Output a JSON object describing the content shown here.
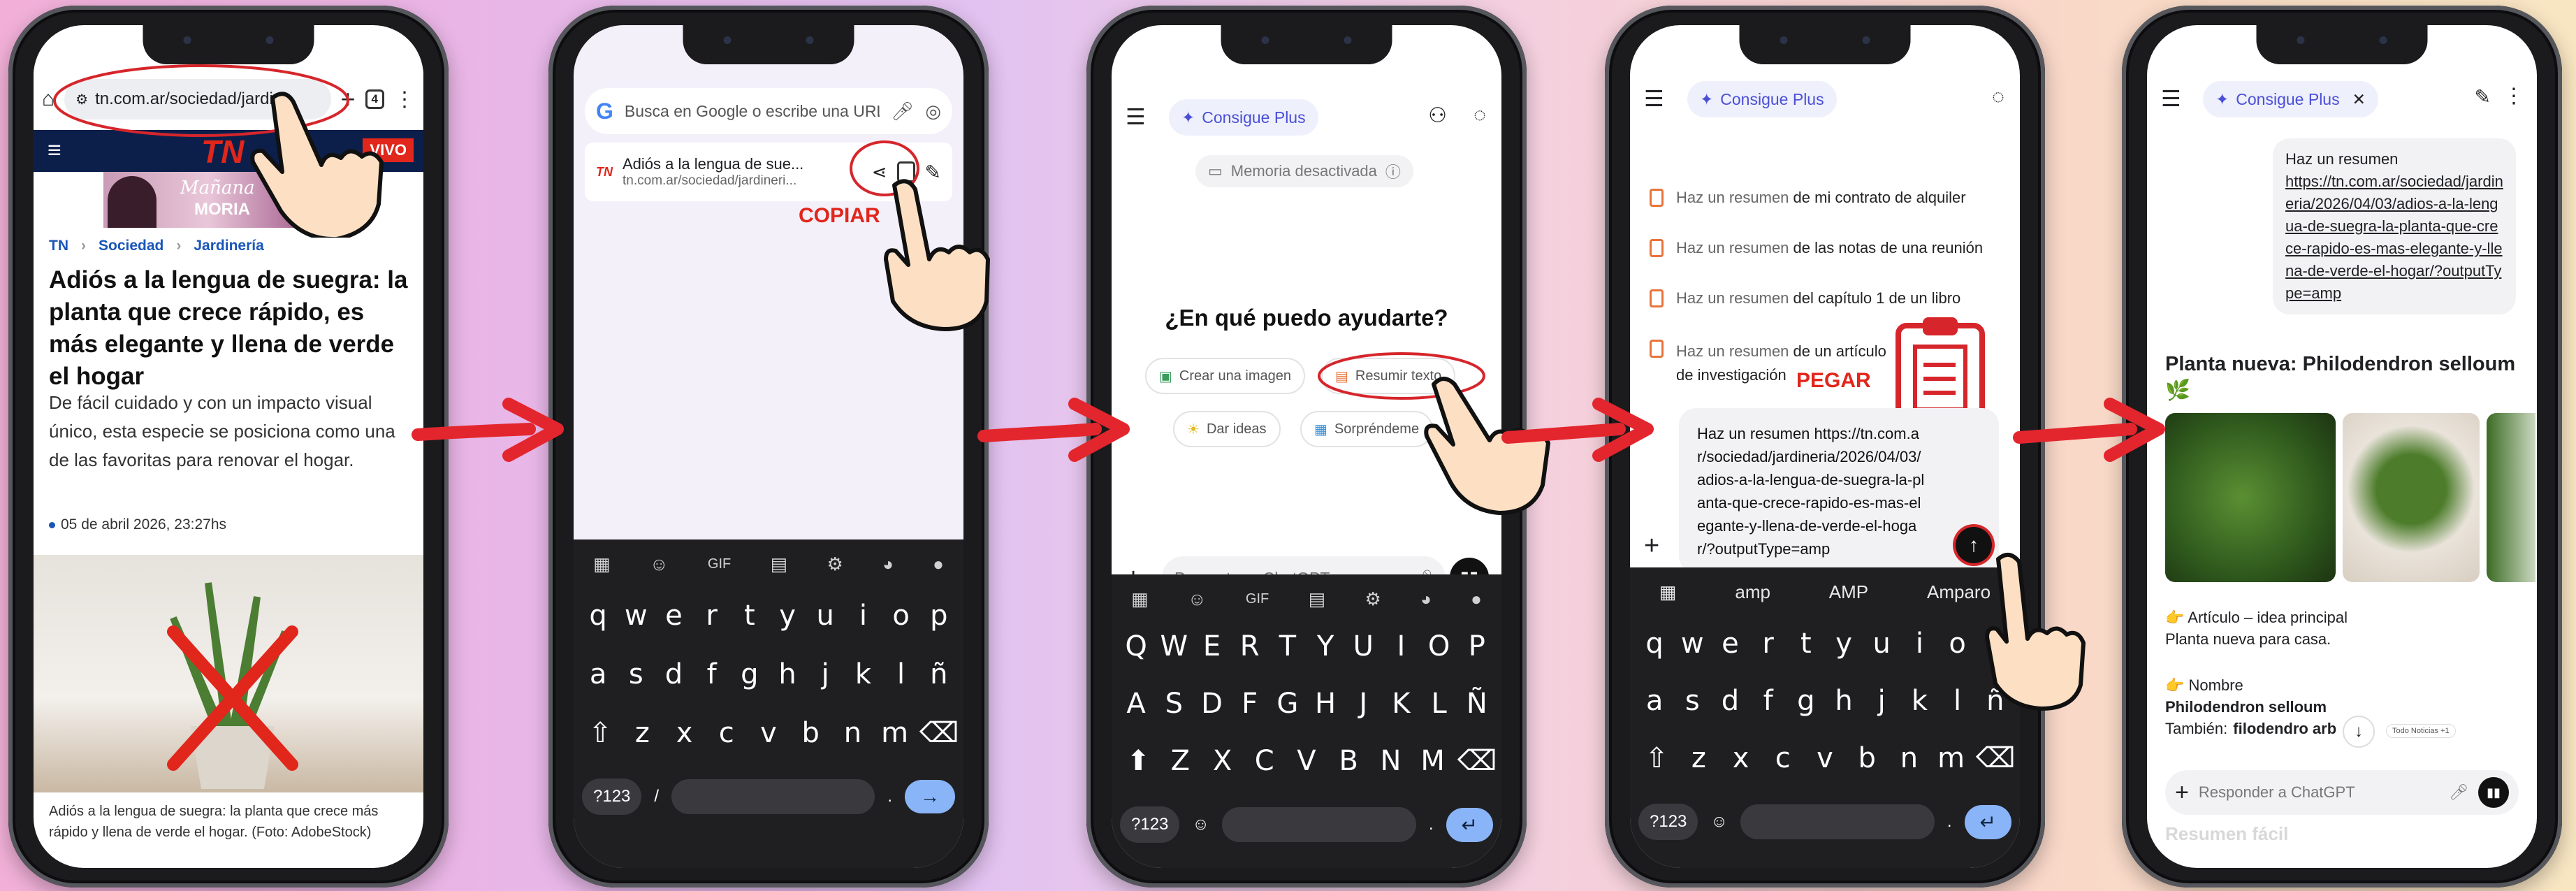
{
  "p1": {
    "url": "tn.com.ar/sociedad/jardi",
    "tab_count": "4",
    "banner": "Mañana",
    "banner2": "MORIA",
    "tn_logo": "TN",
    "vivo": "VIVO",
    "breadcrumb": [
      "TN",
      "Sociedad",
      "Jardinería"
    ],
    "title": "Adiós a la lengua de suegra: la planta que crece rápido, es más elegante y llena de verde el hogar",
    "lead": "De fácil cuidado y con un impacto visual único, esta especie se posiciona como una de las favoritas para renovar el hogar.",
    "date": "05 de abril 2026, 23:27hs",
    "caption": "Adiós a la lengua de suegra: la planta que crece más rápido y llena de verde el hogar. (Foto: AdobeStock)"
  },
  "p2": {
    "search_placeholder": "Busca en Google o escribe una URL",
    "result_title": "Adiós a la lengua de sue...",
    "result_url": "tn.com.ar/sociedad/jardineri...",
    "copiar": "COPIAR",
    "gif": "GIF",
    "rows": [
      [
        "q",
        "w",
        "e",
        "r",
        "t",
        "y",
        "u",
        "i",
        "o",
        "p"
      ],
      [
        "a",
        "s",
        "d",
        "f",
        "g",
        "h",
        "j",
        "k",
        "l",
        "ñ"
      ],
      [
        "z",
        "x",
        "c",
        "v",
        "b",
        "n",
        "m"
      ]
    ],
    "num": "?123",
    "slash": "/",
    "dot": "."
  },
  "p3": {
    "plan": "Consigue Plus",
    "memory": "Memoria desactivada",
    "question": "¿En qué puedo ayudarte?",
    "chips": [
      "Crear una imagen",
      "Resumir texto",
      "Dar ideas",
      "Sorpréndeme"
    ],
    "input_placeholder": "Preguntar a ChatGPT",
    "gif": "GIF",
    "rows": [
      [
        "Q",
        "W",
        "E",
        "R",
        "T",
        "Y",
        "U",
        "I",
        "O",
        "P"
      ],
      [
        "A",
        "S",
        "D",
        "F",
        "G",
        "H",
        "J",
        "K",
        "L",
        "Ñ"
      ],
      [
        "Z",
        "X",
        "C",
        "V",
        "B",
        "N",
        "M"
      ]
    ],
    "num": "?123",
    "dot": "."
  },
  "p4": {
    "plan": "Consigue Plus",
    "suggestions": [
      {
        "a": "Haz un resumen",
        "b": "de mi contrato de alquiler"
      },
      {
        "a": "Haz un resumen",
        "b": "de las notas de una reunión"
      },
      {
        "a": "Haz un resumen",
        "b": "del capítulo 1 de un libro"
      },
      {
        "a": "Haz un resumen",
        "b": "de un artículo de investigación"
      }
    ],
    "pegar": "PEGAR",
    "input_text": "Haz un resumen https://tn.com.ar/sociedad/jardineria/2026/04/03/adios-a-la-lengua-de-suegra-la-planta-que-crece-rapido-es-mas-elegante-y-llena-de-verde-el-hogar/?outputType=amp",
    "kb_suggestions": [
      "amp",
      "AMP",
      "Amparo"
    ],
    "rows": [
      [
        "q",
        "w",
        "e",
        "r",
        "t",
        "y",
        "u",
        "i",
        "o",
        "p"
      ],
      [
        "a",
        "s",
        "d",
        "f",
        "g",
        "h",
        "j",
        "k",
        "l",
        "ñ"
      ],
      [
        "z",
        "x",
        "c",
        "v",
        "b",
        "n",
        "m"
      ]
    ],
    "num": "?123",
    "dot": "."
  },
  "p5": {
    "plan": "Consigue Plus",
    "user_msg_intro": "Haz un resumen",
    "user_msg_link": "https://tn.com.ar/sociedad/jardineria/2026/04/03/adios-a-la-lengua-de-suegra-la-planta-que-crece-rapido-es-mas-elegante-y-llena-de-verde-el-hogar/?outputType=amp",
    "heading": "Planta nueva: Philodendron selloum 🌿",
    "item1_title": "👉 Artículo – idea principal",
    "item1_text": "Planta nueva para casa.",
    "item2_title": "👉 Nombre",
    "item2_bold": "Philodendron selloum",
    "item2_label": "También:",
    "item2_more": "filodendro arb",
    "badge": "Todo Noticias +1",
    "input_placeholder": "Responder a ChatGPT",
    "faded": "Resumen fácil"
  }
}
